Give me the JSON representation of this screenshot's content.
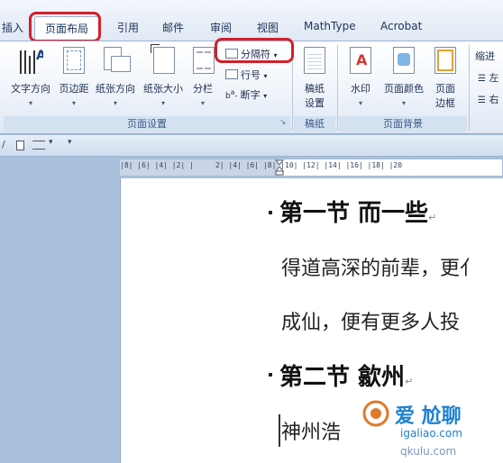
{
  "tabs": [
    {
      "label": "插入"
    },
    {
      "label": "页面布局"
    },
    {
      "label": "引用"
    },
    {
      "label": "邮件"
    },
    {
      "label": "审阅"
    },
    {
      "label": "视图"
    },
    {
      "label": "MathType"
    },
    {
      "label": "Acrobat"
    }
  ],
  "ribbon": {
    "page_setup": {
      "group_label": "页面设置",
      "text_direction": "文字方向",
      "margins": "页边距",
      "orientation": "纸张方向",
      "size": "纸张大小",
      "columns": "分栏",
      "breaks": "分隔符",
      "line_numbers": "行号",
      "hyphenation": "断字"
    },
    "paper": {
      "group_label": "稿纸",
      "settings_line1": "稿纸",
      "settings_line2": "设置"
    },
    "background": {
      "group_label": "页面背景",
      "watermark": "水印",
      "page_color": "页面颜色",
      "page_borders_line1": "页面",
      "page_borders_line2": "边框"
    },
    "paragraph": {
      "indent": "缩进",
      "left": "左",
      "right": "右"
    }
  },
  "ruler": {
    "text": "|8| |6| |4| |2| |     2| |4| |6| |8| |10| |12| |14| |16| |18| |20"
  },
  "document": {
    "heading1": "第一节 而一些",
    "para1": "得道高深的前辈，更亻",
    "para2": "成仙，便有更多人投",
    "heading2": "第二节 歙州",
    "para3": "神州浩"
  },
  "watermark": {
    "line1": "爱 尬聊",
    "line2": "igaliao.com",
    "line3": "qkulu.com"
  },
  "colors": {
    "highlight": "#d4202a",
    "ribbon_bg": "#f0f4fa",
    "workspace": "#a9c0dd"
  }
}
